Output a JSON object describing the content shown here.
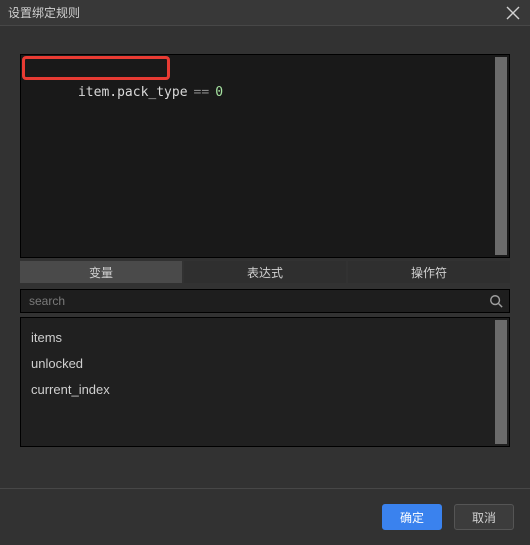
{
  "window": {
    "title": "设置绑定规则"
  },
  "expression": {
    "property": "item.pack_type",
    "operator": "==",
    "value": "0"
  },
  "highlight": {
    "color": "#e83b33"
  },
  "tabs": {
    "items": [
      {
        "label": "变量",
        "active": true
      },
      {
        "label": "表达式",
        "active": false
      },
      {
        "label": "操作符",
        "active": false
      }
    ]
  },
  "search": {
    "placeholder": "search",
    "value": ""
  },
  "variables": [
    {
      "name": "items"
    },
    {
      "name": "unlocked"
    },
    {
      "name": "current_index"
    }
  ],
  "footer": {
    "ok": "确定",
    "cancel": "取消"
  }
}
